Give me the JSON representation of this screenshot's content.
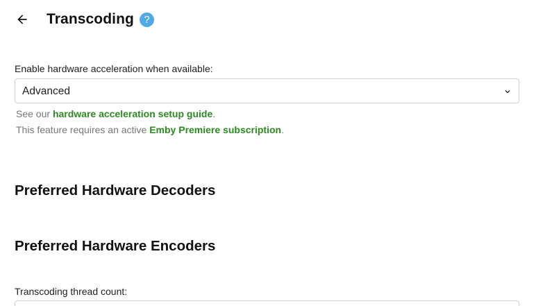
{
  "header": {
    "title": "Transcoding",
    "back_icon": "arrow-left-icon",
    "help_icon": "question-mark-icon",
    "help_glyph": "?",
    "help_color": "#52a9e8"
  },
  "hardware_acceleration": {
    "label": "Enable hardware acceleration when available:",
    "selected": "Advanced",
    "dropdown_icon": "chevron-down-icon",
    "guide_prefix": "See our ",
    "guide_link": "hardware acceleration setup guide",
    "guide_suffix": ".",
    "premiere_prefix": "This feature requires an active ",
    "premiere_link": "Emby Premiere subscription",
    "premiere_suffix": ".",
    "link_color": "#2b8a20"
  },
  "sections": {
    "decoders_heading": "Preferred Hardware Decoders",
    "encoders_heading": "Preferred Hardware Encoders"
  },
  "thread_count": {
    "label": "Transcoding thread count:"
  }
}
